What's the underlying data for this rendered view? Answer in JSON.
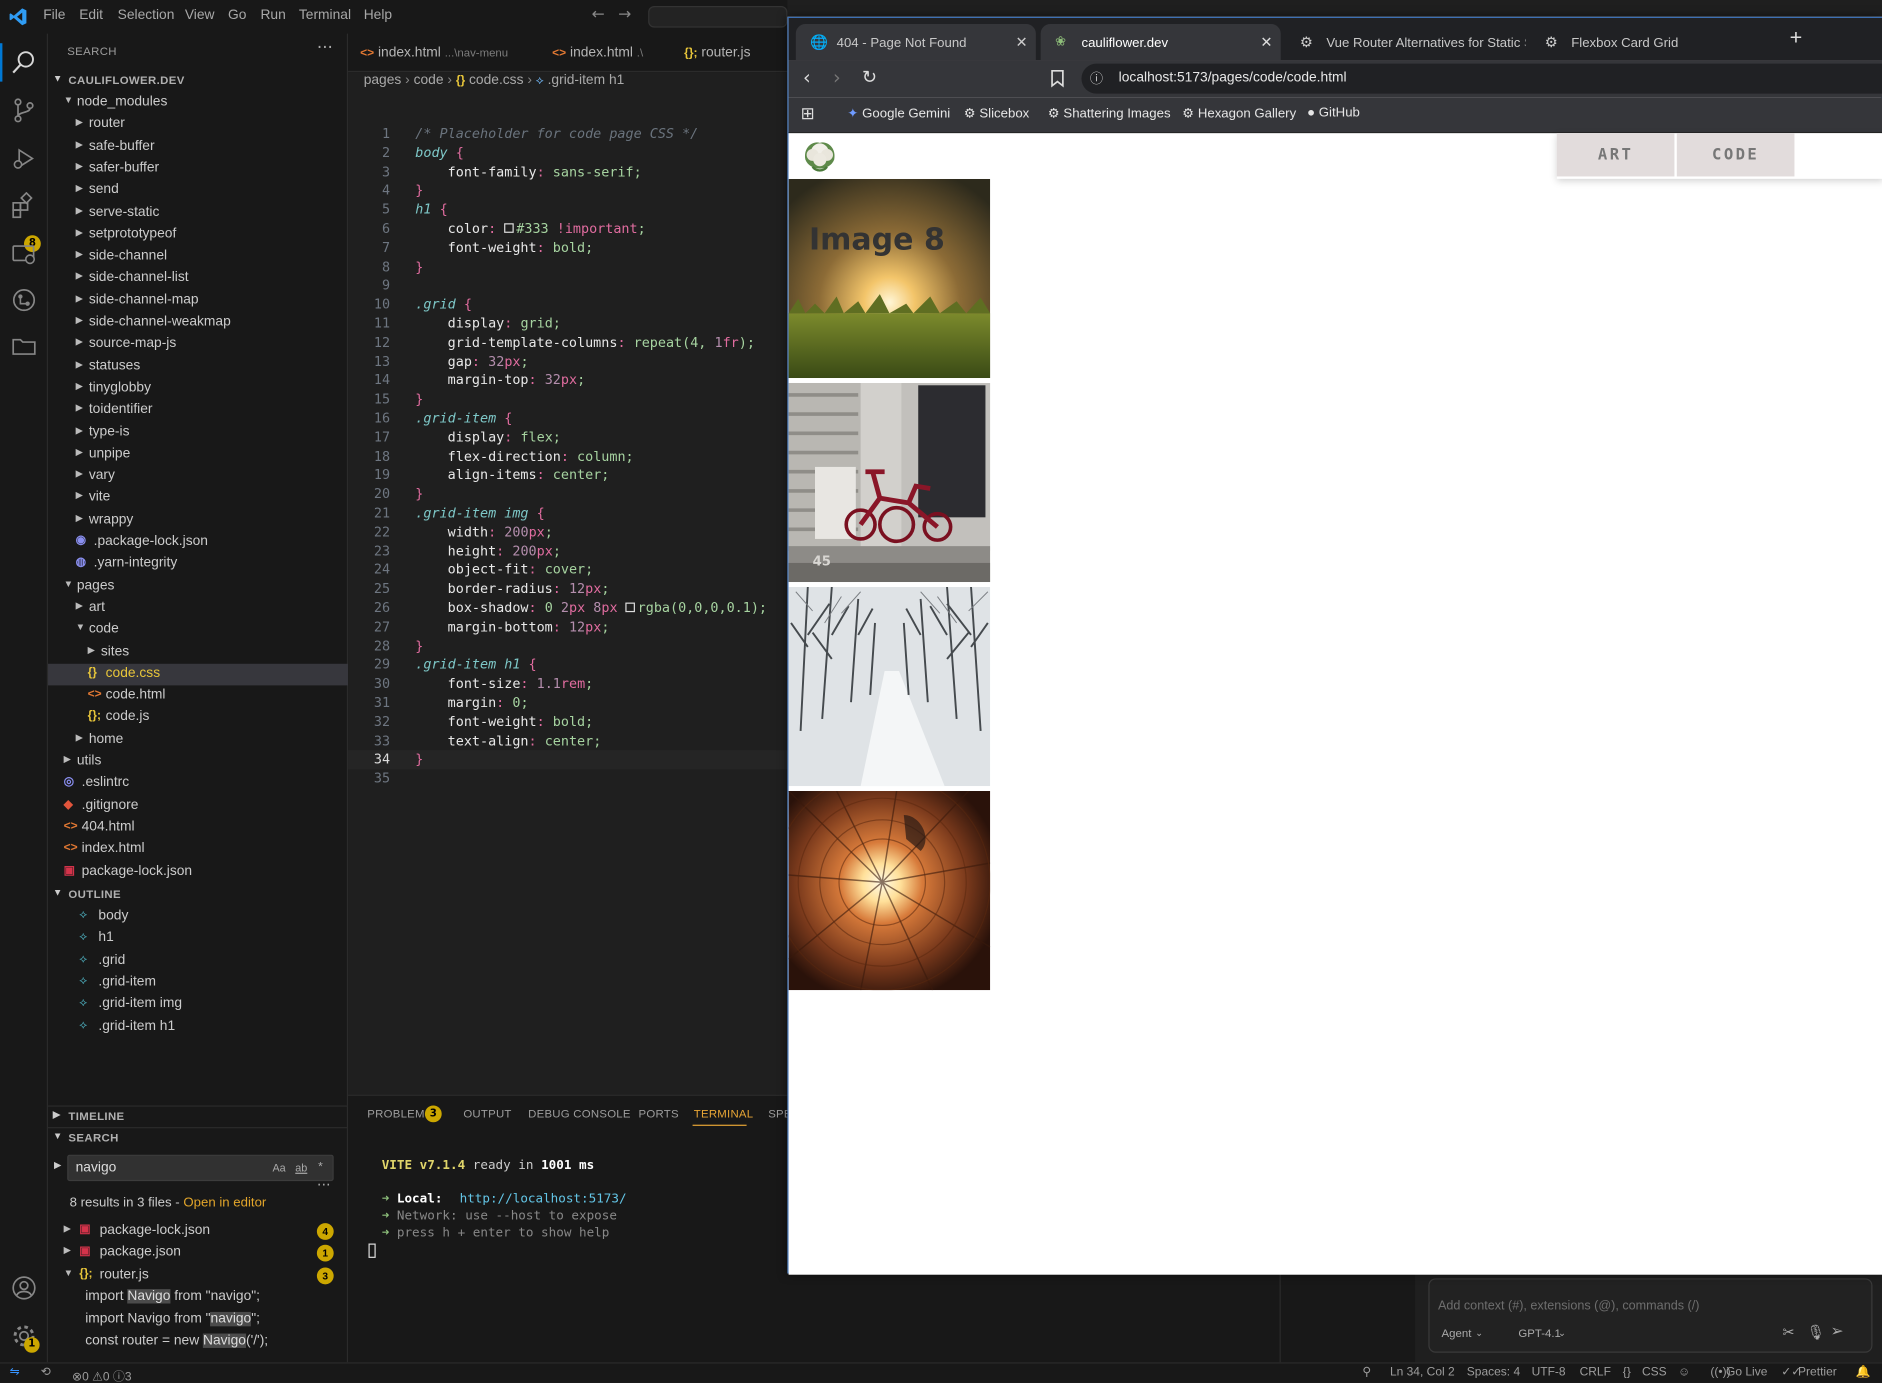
{
  "vscode": {
    "menu": [
      "File",
      "Edit",
      "Selection",
      "View",
      "Go",
      "Run",
      "Terminal",
      "Help"
    ],
    "search_panel_title": "SEARCH",
    "explorer_root": "CAULIFLOWER.DEV",
    "extensions_badge": "8",
    "settings_badge": "1",
    "tree": [
      {
        "label": "node_modules",
        "type": "folder-open",
        "depth": 0
      },
      {
        "label": "router",
        "type": "folder",
        "depth": 1
      },
      {
        "label": "safe-buffer",
        "type": "folder",
        "depth": 1
      },
      {
        "label": "safer-buffer",
        "type": "folder",
        "depth": 1
      },
      {
        "label": "send",
        "type": "folder",
        "depth": 1
      },
      {
        "label": "serve-static",
        "type": "folder",
        "depth": 1
      },
      {
        "label": "setprototypeof",
        "type": "folder",
        "depth": 1
      },
      {
        "label": "side-channel",
        "type": "folder",
        "depth": 1
      },
      {
        "label": "side-channel-list",
        "type": "folder",
        "depth": 1
      },
      {
        "label": "side-channel-map",
        "type": "folder",
        "depth": 1
      },
      {
        "label": "side-channel-weakmap",
        "type": "folder",
        "depth": 1
      },
      {
        "label": "source-map-js",
        "type": "folder",
        "depth": 1
      },
      {
        "label": "statuses",
        "type": "folder",
        "depth": 1
      },
      {
        "label": "tinyglobby",
        "type": "folder",
        "depth": 1
      },
      {
        "label": "toidentifier",
        "type": "folder",
        "depth": 1
      },
      {
        "label": "type-is",
        "type": "folder",
        "depth": 1
      },
      {
        "label": "unpipe",
        "type": "folder",
        "depth": 1
      },
      {
        "label": "vary",
        "type": "folder",
        "depth": 1
      },
      {
        "label": "vite",
        "type": "folder",
        "depth": 1
      },
      {
        "label": "wrappy",
        "type": "folder",
        "depth": 1
      },
      {
        "label": ".package-lock.json",
        "type": "json-config",
        "depth": 1
      },
      {
        "label": ".yarn-integrity",
        "type": "yarn",
        "depth": 1
      },
      {
        "label": "pages",
        "type": "folder-open",
        "depth": 0
      },
      {
        "label": "art",
        "type": "folder",
        "depth": 1
      },
      {
        "label": "code",
        "type": "folder-open",
        "depth": 1
      },
      {
        "label": "sites",
        "type": "folder",
        "depth": 2
      },
      {
        "label": "code.css",
        "type": "css",
        "depth": 2,
        "selected": true
      },
      {
        "label": "code.html",
        "type": "html",
        "depth": 2
      },
      {
        "label": "code.js",
        "type": "js",
        "depth": 2
      },
      {
        "label": "home",
        "type": "folder",
        "depth": 1
      },
      {
        "label": "utils",
        "type": "folder",
        "depth": 0
      },
      {
        "label": ".eslintrc",
        "type": "eslint",
        "depth": 0
      },
      {
        "label": ".gitignore",
        "type": "git",
        "depth": 0
      },
      {
        "label": "404.html",
        "type": "html",
        "depth": 0
      },
      {
        "label": "index.html",
        "type": "html",
        "depth": 0
      },
      {
        "label": "package-lock.json",
        "type": "npm",
        "depth": 0
      }
    ],
    "outline_title": "OUTLINE",
    "outline": [
      "body",
      "h1",
      ".grid",
      ".grid-item",
      ".grid-item img",
      ".grid-item h1"
    ],
    "timeline_title": "TIMELINE",
    "search_title": "SEARCH",
    "search_query": "navigo",
    "search_opts": [
      "Aa",
      "ab",
      "*"
    ],
    "search_summary": "8 results in 3 files - ",
    "search_open_editor": "Open in editor",
    "search_results": [
      {
        "file": "package-lock.json",
        "count": "4",
        "type": "npm"
      },
      {
        "file": "package.json",
        "count": "1",
        "type": "npm"
      },
      {
        "file": "router.js",
        "count": "3",
        "type": "js"
      }
    ],
    "search_matches": [
      {
        "pre": "import ",
        "match": "Navigo",
        "post": " from \"navigo\";"
      },
      {
        "pre": "import Navigo from \"",
        "match": "navigo",
        "post": "\";"
      },
      {
        "pre": "const router = new ",
        "match": "Navigo",
        "post": "('/');"
      }
    ],
    "editor_tabs": [
      {
        "name": "index.html",
        "hint": "...\\nav-menu",
        "type": "html"
      },
      {
        "name": "index.html",
        "hint": ".\\",
        "type": "html"
      },
      {
        "name": "router.js",
        "hint": "",
        "type": "js"
      }
    ],
    "breadcrumb": [
      "pages",
      "code",
      "code.css",
      ".grid-item h1"
    ],
    "code": [
      "/* Placeholder for code page CSS */",
      "body {",
      "    font-family: sans-serif;",
      "}",
      "h1 {",
      "    color: □#333 !important;",
      "    font-weight: bold;",
      "}",
      "",
      ".grid {",
      "    display: grid;",
      "    grid-template-columns: repeat(4, 1fr);",
      "    gap: 32px;",
      "    margin-top: 32px;",
      "}",
      ".grid-item {",
      "    display: flex;",
      "    flex-direction: column;",
      "    align-items: center;",
      "}",
      ".grid-item img {",
      "    width: 200px;",
      "    height: 200px;",
      "    object-fit: cover;",
      "    border-radius: 12px;",
      "    box-shadow: 0 2px 8px □rgba(0,0,0,0.1);",
      "    margin-bottom: 12px;",
      "}",
      ".grid-item h1 {",
      "    font-size: 1.1rem;",
      "    margin: 0;",
      "    font-weight: bold;",
      "    text-align: center;",
      "}",
      ""
    ],
    "current_line": 34,
    "panel_tabs": [
      "PROBLEMS",
      "OUTPUT",
      "DEBUG CONSOLE",
      "PORTS",
      "TERMINAL",
      "SPE"
    ],
    "problems_badge": "3",
    "terminal": {
      "vite": "VITE v7.1.4",
      "ready": "ready in",
      "ms": "1001 ms",
      "local_label": "Local:",
      "local_url": "http://localhost:5173/",
      "network_label": "Network:",
      "network_text": "use --host to expose",
      "help_text": "press h + enter to show help"
    },
    "chat_placeholder": "Add context (#), extensions (@), commands (/)",
    "agent_label": "Agent",
    "model_label": "GPT-4.1",
    "status": {
      "errors": "0",
      "warnings": "0",
      "info": "3",
      "position": "Ln 34, Col 2",
      "spaces": "Spaces: 4",
      "encoding": "UTF-8",
      "eol": "CRLF",
      "language": "CSS",
      "golive": "Go Live",
      "prettier": "Prettier"
    }
  },
  "browser": {
    "tabs": [
      {
        "title": "404 - Page Not Found",
        "active": false
      },
      {
        "title": "cauliflower.dev",
        "active": true
      },
      {
        "title": "Vue Router Alternatives for Static Site",
        "active": false
      },
      {
        "title": "Flexbox Card Grid",
        "active": false
      }
    ],
    "new_tab": "+",
    "url": "localhost:5173/pages/code/code.html",
    "bookmarks": [
      "Google Gemini",
      "Slicebox",
      "Shattering Images",
      "Hexagon Gallery",
      "GitHub"
    ],
    "nav_art": "ART",
    "nav_code": "CODE",
    "image_caption": "Image 8"
  },
  "colors": {
    "accent": "#0078d4",
    "keyword_pink": "#e06c9f",
    "property": "#d4d4d4",
    "value": "#9cdcfe",
    "comment": "#6a9955",
    "badge": "#cca700"
  }
}
